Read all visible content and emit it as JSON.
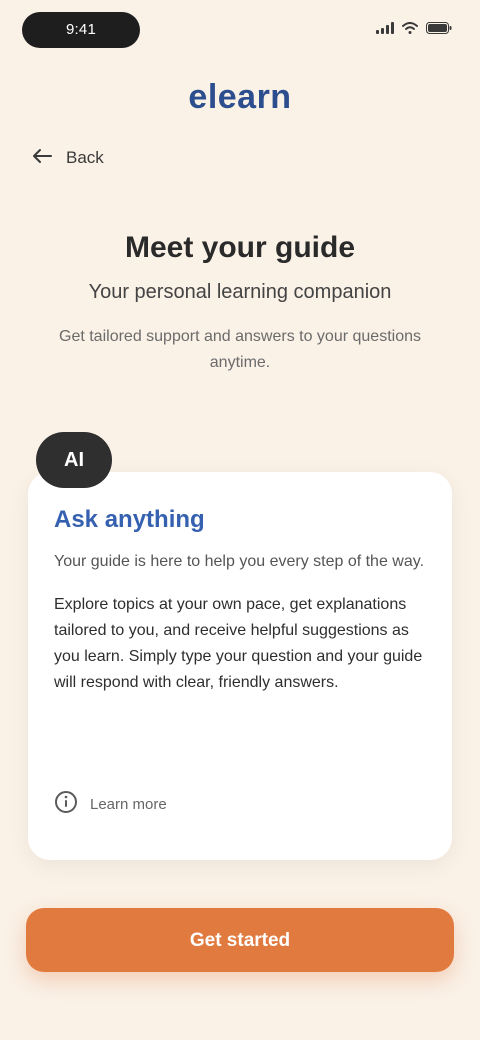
{
  "status_bar": {
    "time": "9:41",
    "icons": [
      "signal-icon",
      "wifi-icon",
      "battery-icon"
    ]
  },
  "brand": {
    "logo_text": "elearn"
  },
  "nav": {
    "back_label": "Back",
    "back_icon": "arrow-left-icon"
  },
  "hero": {
    "title": "Meet your guide",
    "subtitle": "Your personal learning companion",
    "description": "Get tailored support and answers to your questions anytime."
  },
  "card": {
    "avatar_text": "AI",
    "title": "Ask anything",
    "lead": "Your guide is here to help you every step of the way.",
    "body": "Explore topics at your own pace, get explanations tailored to you, and receive helpful suggestions as you learn. Simply type your question and your guide will respond with clear, friendly answers.",
    "footer_label": "Learn more",
    "footer_icon": "info-icon"
  },
  "cta": {
    "label": "Get started"
  },
  "colors": {
    "background": "#FAF1E7",
    "brand": "#2D4E8E",
    "accent": "#3561B0",
    "cta": "#E17A3F"
  }
}
